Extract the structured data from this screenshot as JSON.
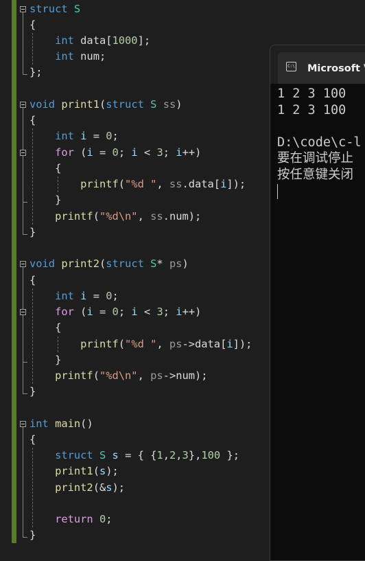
{
  "editor": {
    "colors": {
      "background": "#1e1e1e",
      "keyword": "#569cd6",
      "control": "#d8a0df",
      "type": "#4ec9b0",
      "function": "#dcdcaa",
      "number": "#b5cea8",
      "string": "#d69d85",
      "variable": "#9cdcfe",
      "parameter": "#9a9a9a",
      "changebar": "#5b7a2c"
    },
    "lines": [
      [
        [
          "k",
          "struct"
        ],
        [
          "o",
          " "
        ],
        [
          "t",
          "S"
        ]
      ],
      [
        [
          "o",
          "{"
        ]
      ],
      [
        [
          "o",
          "    "
        ],
        [
          "k",
          "int"
        ],
        [
          "o",
          " data["
        ],
        [
          "n",
          "1000"
        ],
        [
          "o",
          "];"
        ]
      ],
      [
        [
          "o",
          "    "
        ],
        [
          "k",
          "int"
        ],
        [
          "o",
          " num;"
        ]
      ],
      [
        [
          "o",
          "};"
        ]
      ],
      [],
      [
        [
          "k",
          "void"
        ],
        [
          "o",
          " "
        ],
        [
          "f",
          "print1"
        ],
        [
          "o",
          "("
        ],
        [
          "k",
          "struct"
        ],
        [
          "o",
          " "
        ],
        [
          "t",
          "S"
        ],
        [
          "o",
          " "
        ],
        [
          "p",
          "ss"
        ],
        [
          "o",
          ")"
        ]
      ],
      [
        [
          "o",
          "{"
        ]
      ],
      [
        [
          "o",
          "    "
        ],
        [
          "k",
          "int"
        ],
        [
          "o",
          " "
        ],
        [
          "v",
          "i"
        ],
        [
          "o",
          " = "
        ],
        [
          "n",
          "0"
        ],
        [
          "o",
          ";"
        ]
      ],
      [
        [
          "o",
          "    "
        ],
        [
          "c",
          "for"
        ],
        [
          "o",
          " ("
        ],
        [
          "v",
          "i"
        ],
        [
          "o",
          " = "
        ],
        [
          "n",
          "0"
        ],
        [
          "o",
          "; "
        ],
        [
          "v",
          "i"
        ],
        [
          "o",
          " < "
        ],
        [
          "n",
          "3"
        ],
        [
          "o",
          "; "
        ],
        [
          "v",
          "i"
        ],
        [
          "o",
          "++)"
        ]
      ],
      [
        [
          "o",
          "    {"
        ]
      ],
      [
        [
          "o",
          "        "
        ],
        [
          "f",
          "printf"
        ],
        [
          "o",
          "("
        ],
        [
          "s",
          "\"%d \""
        ],
        [
          "o",
          ", "
        ],
        [
          "p",
          "ss"
        ],
        [
          "o",
          ".data["
        ],
        [
          "v",
          "i"
        ],
        [
          "o",
          "]);"
        ]
      ],
      [
        [
          "o",
          "    }"
        ]
      ],
      [
        [
          "o",
          "    "
        ],
        [
          "f",
          "printf"
        ],
        [
          "o",
          "("
        ],
        [
          "s",
          "\"%d\\n\""
        ],
        [
          "o",
          ", "
        ],
        [
          "p",
          "ss"
        ],
        [
          "o",
          ".num);"
        ]
      ],
      [
        [
          "o",
          "}"
        ]
      ],
      [],
      [
        [
          "k",
          "void"
        ],
        [
          "o",
          " "
        ],
        [
          "f",
          "print2"
        ],
        [
          "o",
          "("
        ],
        [
          "k",
          "struct"
        ],
        [
          "o",
          " "
        ],
        [
          "t",
          "S"
        ],
        [
          "o",
          "* "
        ],
        [
          "p",
          "ps"
        ],
        [
          "o",
          ")"
        ]
      ],
      [
        [
          "o",
          "{"
        ]
      ],
      [
        [
          "o",
          "    "
        ],
        [
          "k",
          "int"
        ],
        [
          "o",
          " "
        ],
        [
          "v",
          "i"
        ],
        [
          "o",
          " = "
        ],
        [
          "n",
          "0"
        ],
        [
          "o",
          ";"
        ]
      ],
      [
        [
          "o",
          "    "
        ],
        [
          "c",
          "for"
        ],
        [
          "o",
          " ("
        ],
        [
          "v",
          "i"
        ],
        [
          "o",
          " = "
        ],
        [
          "n",
          "0"
        ],
        [
          "o",
          "; "
        ],
        [
          "v",
          "i"
        ],
        [
          "o",
          " < "
        ],
        [
          "n",
          "3"
        ],
        [
          "o",
          "; "
        ],
        [
          "v",
          "i"
        ],
        [
          "o",
          "++)"
        ]
      ],
      [
        [
          "o",
          "    {"
        ]
      ],
      [
        [
          "o",
          "        "
        ],
        [
          "f",
          "printf"
        ],
        [
          "o",
          "("
        ],
        [
          "s",
          "\"%d \""
        ],
        [
          "o",
          ", "
        ],
        [
          "p",
          "ps"
        ],
        [
          "o",
          "->data["
        ],
        [
          "v",
          "i"
        ],
        [
          "o",
          "]);"
        ]
      ],
      [
        [
          "o",
          "    }"
        ]
      ],
      [
        [
          "o",
          "    "
        ],
        [
          "f",
          "printf"
        ],
        [
          "o",
          "("
        ],
        [
          "s",
          "\"%d\\n\""
        ],
        [
          "o",
          ", "
        ],
        [
          "p",
          "ps"
        ],
        [
          "o",
          "->num);"
        ]
      ],
      [
        [
          "o",
          "}"
        ]
      ],
      [],
      [
        [
          "k",
          "int"
        ],
        [
          "o",
          " "
        ],
        [
          "f",
          "main"
        ],
        [
          "o",
          "()"
        ]
      ],
      [
        [
          "o",
          "{"
        ]
      ],
      [
        [
          "o",
          "    "
        ],
        [
          "k",
          "struct"
        ],
        [
          "o",
          " "
        ],
        [
          "t",
          "S"
        ],
        [
          "o",
          " "
        ],
        [
          "v",
          "s"
        ],
        [
          "o",
          " = { {"
        ],
        [
          "n",
          "1"
        ],
        [
          "o",
          ","
        ],
        [
          "n",
          "2"
        ],
        [
          "o",
          ","
        ],
        [
          "n",
          "3"
        ],
        [
          "o",
          "},"
        ],
        [
          "n",
          "100"
        ],
        [
          "o",
          " };"
        ]
      ],
      [
        [
          "o",
          "    "
        ],
        [
          "f",
          "print1"
        ],
        [
          "o",
          "("
        ],
        [
          "v",
          "s"
        ],
        [
          "o",
          ");"
        ]
      ],
      [
        [
          "o",
          "    "
        ],
        [
          "f",
          "print2"
        ],
        [
          "o",
          "(&"
        ],
        [
          "v",
          "s"
        ],
        [
          "o",
          ");"
        ]
      ],
      [],
      [
        [
          "o",
          "    "
        ],
        [
          "c",
          "return"
        ],
        [
          "o",
          " "
        ],
        [
          "n",
          "0"
        ],
        [
          "o",
          ";"
        ]
      ],
      [
        [
          "o",
          "}"
        ]
      ]
    ]
  },
  "console": {
    "tab_icon": "cmd-icon",
    "tab_icon_text": "C:\\",
    "tab_title": "Microsoft Visual Studio 调试控制台",
    "output": [
      "1 2 3 100",
      "1 2 3 100",
      "",
      "D:\\code\\c-l",
      "要在调试停止",
      "按任意键关闭"
    ]
  }
}
